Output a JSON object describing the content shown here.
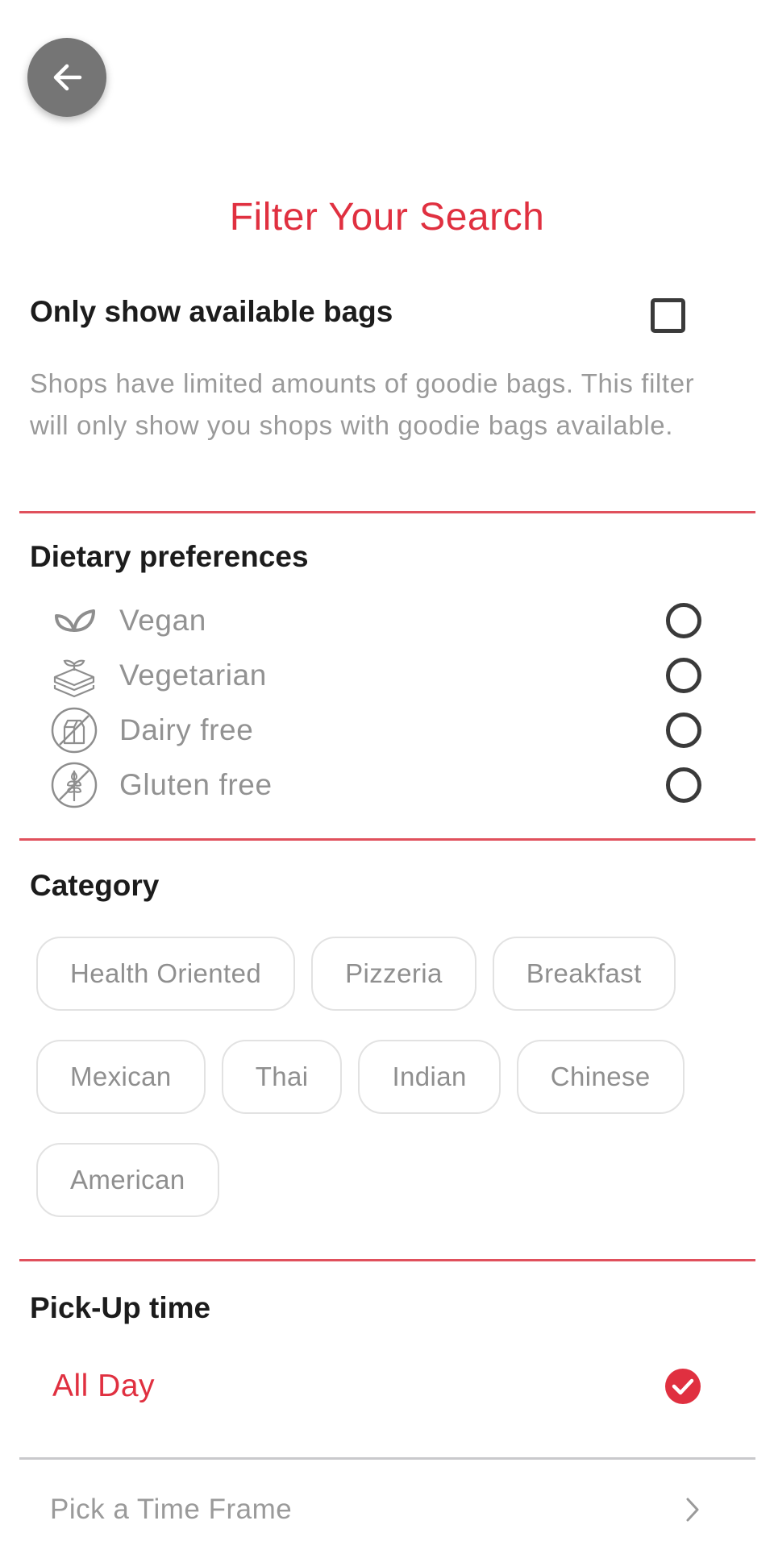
{
  "header": {
    "back_icon": "arrow-left-icon",
    "title": "Filter Your Search"
  },
  "availability": {
    "label": "Only show available bags",
    "checked": false,
    "description": "Shops have limited amounts of goodie bags. This filter will only show you shops with goodie bags available."
  },
  "dietary": {
    "heading": "Dietary preferences",
    "options": [
      {
        "label": "Vegan",
        "icon": "leaves-icon",
        "selected": false
      },
      {
        "label": "Vegetarian",
        "icon": "sprout-layers-icon",
        "selected": false
      },
      {
        "label": "Dairy free",
        "icon": "no-milk-carton-icon",
        "selected": false
      },
      {
        "label": "Gluten free",
        "icon": "no-wheat-icon",
        "selected": false
      }
    ]
  },
  "category": {
    "heading": "Category",
    "rows": [
      [
        "Health Oriented",
        "Pizzeria",
        "Breakfast"
      ],
      [
        "Mexican",
        "Thai",
        "Indian",
        "Chinese"
      ],
      [
        "American"
      ]
    ]
  },
  "pickup": {
    "heading": "Pick-Up time",
    "all_day_label": "All Day",
    "all_day_selected": true,
    "time_frame_label": "Pick a Time Frame"
  },
  "colors": {
    "accent": "#e03040",
    "divider": "#e0505c",
    "muted_text": "#9a9a9a",
    "back_button": "#757575"
  }
}
